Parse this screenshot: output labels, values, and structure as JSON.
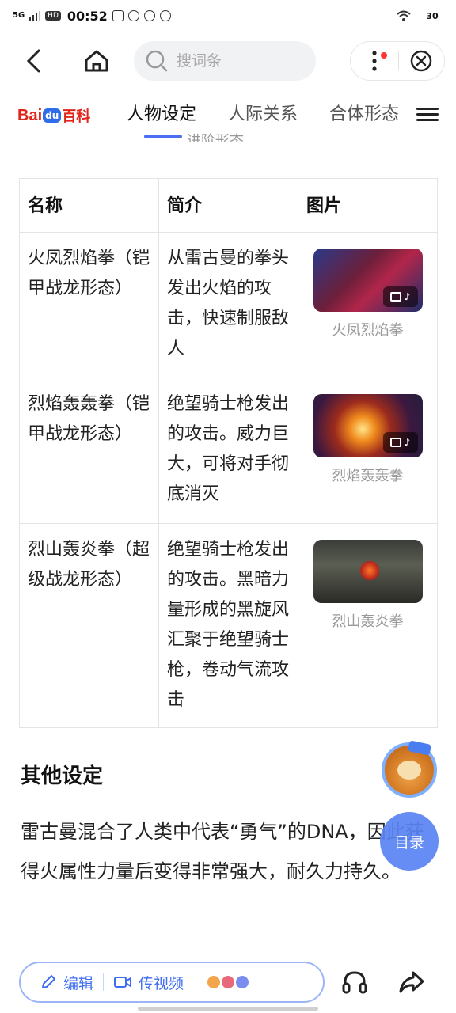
{
  "status_bar": {
    "network": "5G",
    "hd": "HD",
    "time": "00:52",
    "battery": "30"
  },
  "nav": {
    "search_placeholder": "搜词条"
  },
  "brand": {
    "logo_bai": "Bai",
    "logo_du": "du",
    "logo_baike": "百科"
  },
  "tabs": [
    {
      "label": "人物设定",
      "active": true
    },
    {
      "label": "人际关系",
      "active": false
    },
    {
      "label": "合体形态",
      "active": false
    }
  ],
  "cropped_heading": "进阶形态",
  "table": {
    "headers": [
      "名称",
      "简介",
      "图片"
    ],
    "rows": [
      {
        "name": "火凤烈焰拳（铠甲战龙形态）",
        "desc": "从雷古曼的拳头发出火焰的攻击，快速制服敌人",
        "caption": "火凤烈焰拳"
      },
      {
        "name": "烈焰轰轰拳（铠甲战龙形态）",
        "desc": "绝望骑士枪发出的攻击。威力巨大，可将对手彻底消灭",
        "caption": "烈焰轰轰拳"
      },
      {
        "name": "烈山轰炎拳（超级战龙形态）",
        "desc": "绝望骑士枪发出的攻击。黑暗力量形成的黑旋风汇聚于绝望骑士枪，卷动气流攻击",
        "caption": "烈山轰炎拳"
      }
    ]
  },
  "section": {
    "title": "其他设定",
    "body": "雷古曼混合了人类中代表“勇气”的DNA，因此获得火属性力量后变得非常强大，耐久力持久。"
  },
  "toc_label": "目录",
  "bottom_bar": {
    "edit_label": "编辑",
    "video_label": "传视频"
  },
  "colors": {
    "accent": "#4e6ef2",
    "brand_red": "#e1251b",
    "toc_blue": "#5a84f4"
  }
}
